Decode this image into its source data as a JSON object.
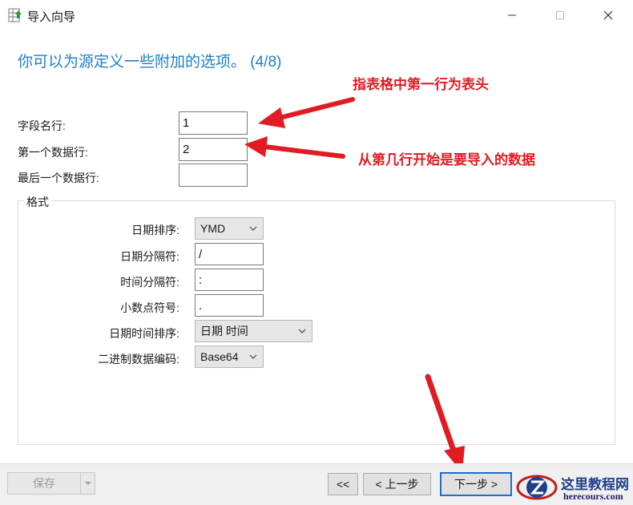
{
  "window": {
    "title": "导入向导",
    "app_icon": "table-import-icon",
    "controls": [
      "minimize-icon",
      "maximize-icon",
      "close-icon"
    ]
  },
  "heading": "你可以为源定义一些附加的选项。 (4/8)",
  "fields": {
    "field_name_row": {
      "label": "字段名行:",
      "value": "1"
    },
    "first_data_row": {
      "label": "第一个数据行:",
      "value": "2"
    },
    "last_data_row": {
      "label": "最后一个数据行:",
      "value": ""
    }
  },
  "format_group": {
    "title": "格式",
    "date_order": {
      "label": "日期排序:",
      "value": "YMD"
    },
    "date_separator": {
      "label": "日期分隔符:",
      "value": "/"
    },
    "time_separator": {
      "label": "时间分隔符:",
      "value": ":"
    },
    "decimal_symbol": {
      "label": "小数点符号:",
      "value": "."
    },
    "datetime_order": {
      "label": "日期时间排序:",
      "value": "日期 时间"
    },
    "binary_encoding": {
      "label": "二进制数据编码:",
      "value": "Base64"
    }
  },
  "annotations": {
    "header_note": "指表格中第一行为表头",
    "data_note": "从第几行开始是要导入的数据",
    "color": "#e01b22"
  },
  "buttons": {
    "save": "保存",
    "first": "<<",
    "prev": "< 上一步",
    "next": "下一步 >"
  },
  "watermark": {
    "cn": "这里教程网",
    "en": "herecours.com"
  },
  "colors": {
    "heading": "#1f7fc4",
    "accent_border": "#1f6fc4",
    "watermark": "#1f3f8c"
  }
}
